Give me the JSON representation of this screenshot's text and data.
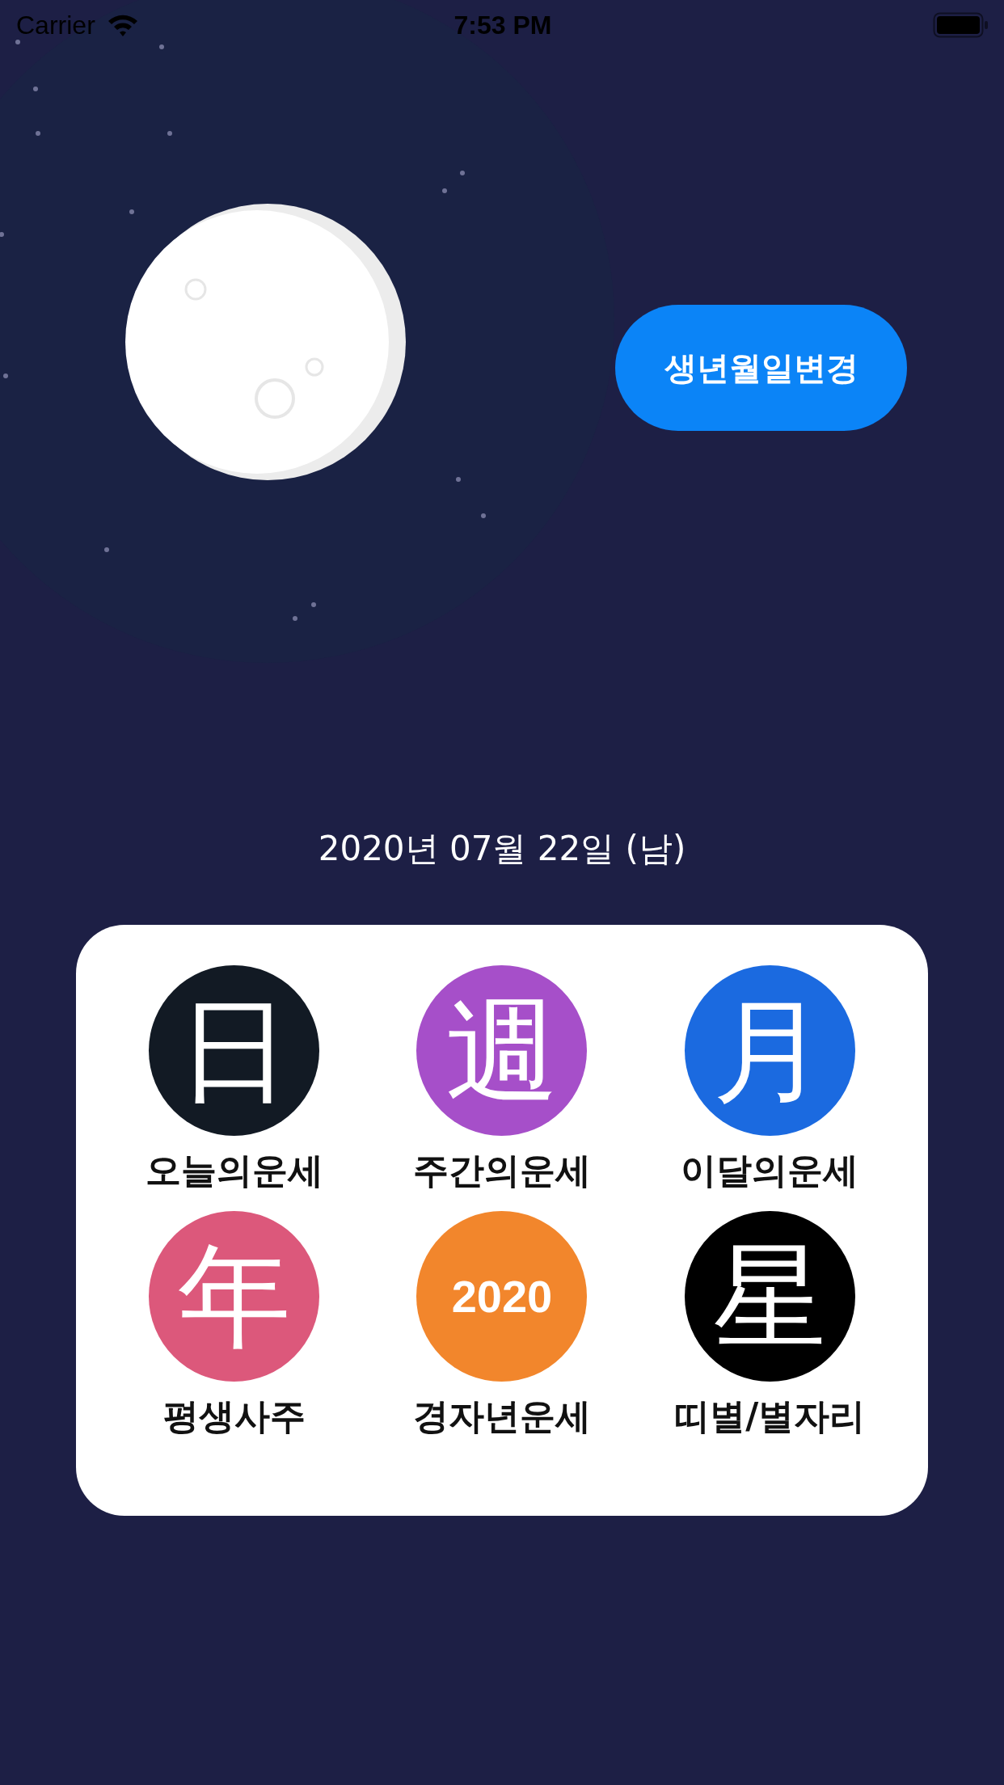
{
  "status_bar": {
    "carrier": "Carrier",
    "time": "7:53 PM"
  },
  "change_button": {
    "label": "생년월일변경"
  },
  "birth_date": "2020년 07월 22일 (남)",
  "menu": [
    {
      "kind": "hanja",
      "glyph": "日",
      "label": "오늘의운세",
      "color": "#121a24"
    },
    {
      "kind": "hanja",
      "glyph": "週",
      "label": "주간의운세",
      "color": "#a64fc9"
    },
    {
      "kind": "hanja",
      "glyph": "月",
      "label": "이달의운세",
      "color": "#1b6ae0"
    },
    {
      "kind": "hanja",
      "glyph": "年",
      "label": "평생사주",
      "color": "#dc587b"
    },
    {
      "kind": "year",
      "glyph": "2020",
      "label": "경자년운세",
      "color": "#f2862c"
    },
    {
      "kind": "hanja",
      "glyph": "星",
      "label": "띠별/별자리",
      "color": "#000000"
    }
  ]
}
